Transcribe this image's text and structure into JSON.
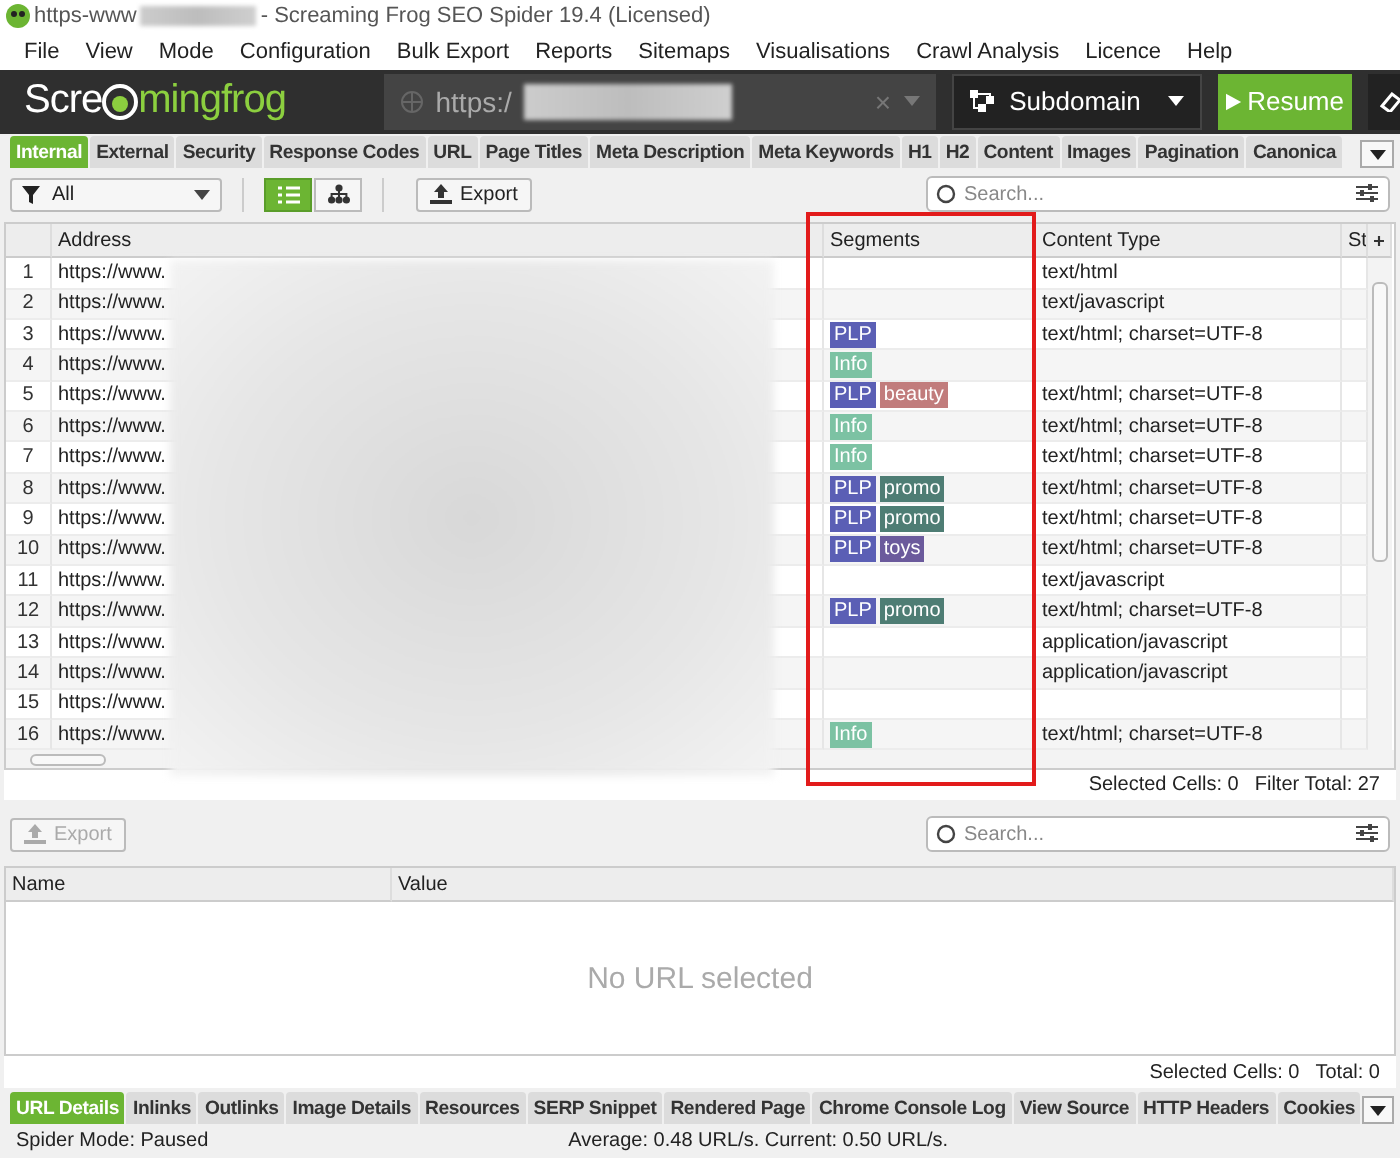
{
  "window": {
    "title_prefix": "https-www",
    "title": "- Screaming Frog SEO Spider 19.4 (Licensed)"
  },
  "menu": [
    "File",
    "View",
    "Mode",
    "Configuration",
    "Bulk Export",
    "Reports",
    "Sitemaps",
    "Visualisations",
    "Crawl Analysis",
    "Licence",
    "Help"
  ],
  "header": {
    "logo_start": "Scre",
    "logo_end": "mingfrog",
    "url": "https:/",
    "clear": "×",
    "mode": "Subdomain",
    "resume": "Resume"
  },
  "tabs": [
    {
      "label": "Internal",
      "selected": true
    },
    {
      "label": "External",
      "selected": false
    },
    {
      "label": "Security",
      "selected": false
    },
    {
      "label": "Response Codes",
      "selected": false
    },
    {
      "label": "URL",
      "selected": false
    },
    {
      "label": "Page Titles",
      "selected": false
    },
    {
      "label": "Meta Description",
      "selected": false
    },
    {
      "label": "Meta Keywords",
      "selected": false
    },
    {
      "label": "H1",
      "selected": false
    },
    {
      "label": "H2",
      "selected": false
    },
    {
      "label": "Content",
      "selected": false
    },
    {
      "label": "Images",
      "selected": false
    },
    {
      "label": "Pagination",
      "selected": false
    },
    {
      "label": "Canonica",
      "selected": false
    }
  ],
  "toolbar": {
    "filter": "All",
    "views": [
      {
        "kind": "list",
        "selected": true
      },
      {
        "kind": "tree",
        "selected": false
      }
    ],
    "export": "Export",
    "search_placeholder": "Search..."
  },
  "table": {
    "columns": [
      "Address",
      "Segments",
      "Content Type",
      "St"
    ],
    "rows": [
      {
        "num": "1",
        "address": "https://www.",
        "segments": [],
        "content_type": "text/html"
      },
      {
        "num": "2",
        "address": "https://www.",
        "segments": [],
        "content_type": "text/javascript"
      },
      {
        "num": "3",
        "address": "https://www.",
        "segments": [
          {
            "label": "PLP",
            "color": "#5b5fb5"
          }
        ],
        "content_type": "text/html; charset=UTF-8"
      },
      {
        "num": "4",
        "address": "https://www.",
        "segments": [
          {
            "label": "Info",
            "color": "#7cc2a3"
          }
        ]
      },
      {
        "num": "5",
        "address": "https://www.",
        "segments": [
          {
            "label": "PLP",
            "color": "#5b5fb5"
          },
          {
            "label": "beauty",
            "color": "#c17c7c"
          }
        ],
        "content_type": "text/html; charset=UTF-8"
      },
      {
        "num": "6",
        "address": "https://www.",
        "segments": [
          {
            "label": "Info",
            "color": "#7cc2a3"
          }
        ],
        "content_type": "text/html; charset=UTF-8"
      },
      {
        "num": "7",
        "address": "https://www.",
        "segments": [
          {
            "label": "Info",
            "color": "#7cc2a3"
          }
        ],
        "content_type": "text/html; charset=UTF-8"
      },
      {
        "num": "8",
        "address": "https://www.",
        "segments": [
          {
            "label": "PLP",
            "color": "#5b5fb5"
          },
          {
            "label": "promo",
            "color": "#4e7d74"
          }
        ],
        "content_type": "text/html; charset=UTF-8"
      },
      {
        "num": "9",
        "address": "https://www.",
        "segments": [
          {
            "label": "PLP",
            "color": "#5b5fb5"
          },
          {
            "label": "promo",
            "color": "#4e7d74"
          }
        ],
        "content_type": "text/html; charset=UTF-8"
      },
      {
        "num": "10",
        "address": "https://www.",
        "segments": [
          {
            "label": "PLP",
            "color": "#5b5fb5"
          },
          {
            "label": "toys",
            "color": "#6b5a9c"
          }
        ],
        "content_type": "text/html; charset=UTF-8"
      },
      {
        "num": "11",
        "address": "https://www.",
        "segments": [],
        "content_type": "text/javascript"
      },
      {
        "num": "12",
        "address": "https://www.",
        "segments": [
          {
            "label": "PLP",
            "color": "#5b5fb5"
          },
          {
            "label": "promo",
            "color": "#4e7d74"
          }
        ],
        "content_type": "text/html; charset=UTF-8"
      },
      {
        "num": "13",
        "address": "https://www.",
        "segments": [],
        "content_type": "application/javascript"
      },
      {
        "num": "14",
        "address": "https://www.",
        "segments": [],
        "content_type": "application/javascript"
      },
      {
        "num": "15",
        "address": "https://www.",
        "segments": []
      },
      {
        "num": "16",
        "address": "https://www.",
        "segments": [
          {
            "label": "Info",
            "color": "#7cc2a3"
          }
        ],
        "content_type": "text/html; charset=UTF-8"
      }
    ],
    "selected_cells": "Selected Cells: 0",
    "filter_total": "Filter Total: 27"
  },
  "details": {
    "export": "Export",
    "export_disabled": true,
    "search_placeholder": "Search...",
    "columns": [
      "Name",
      "Value"
    ],
    "empty_message": "No URL selected",
    "selected_cells": "Selected Cells: 0",
    "total": "Total: 0"
  },
  "bottom_tabs": [
    {
      "label": "URL Details",
      "selected": true
    },
    {
      "label": "Inlinks",
      "selected": false
    },
    {
      "label": "Outlinks",
      "selected": false
    },
    {
      "label": "Image Details",
      "selected": false
    },
    {
      "label": "Resources",
      "selected": false
    },
    {
      "label": "SERP Snippet",
      "selected": false
    },
    {
      "label": "Rendered Page",
      "selected": false
    },
    {
      "label": "Chrome Console Log",
      "selected": false
    },
    {
      "label": "View Source",
      "selected": false
    },
    {
      "label": "HTTP Headers",
      "selected": false
    },
    {
      "label": "Cookies",
      "selected": false
    }
  ],
  "status_bar": {
    "mode": "Spider Mode: Paused",
    "speed": "Average: 0.48 URL/s. Current: 0.50 URL/s."
  }
}
